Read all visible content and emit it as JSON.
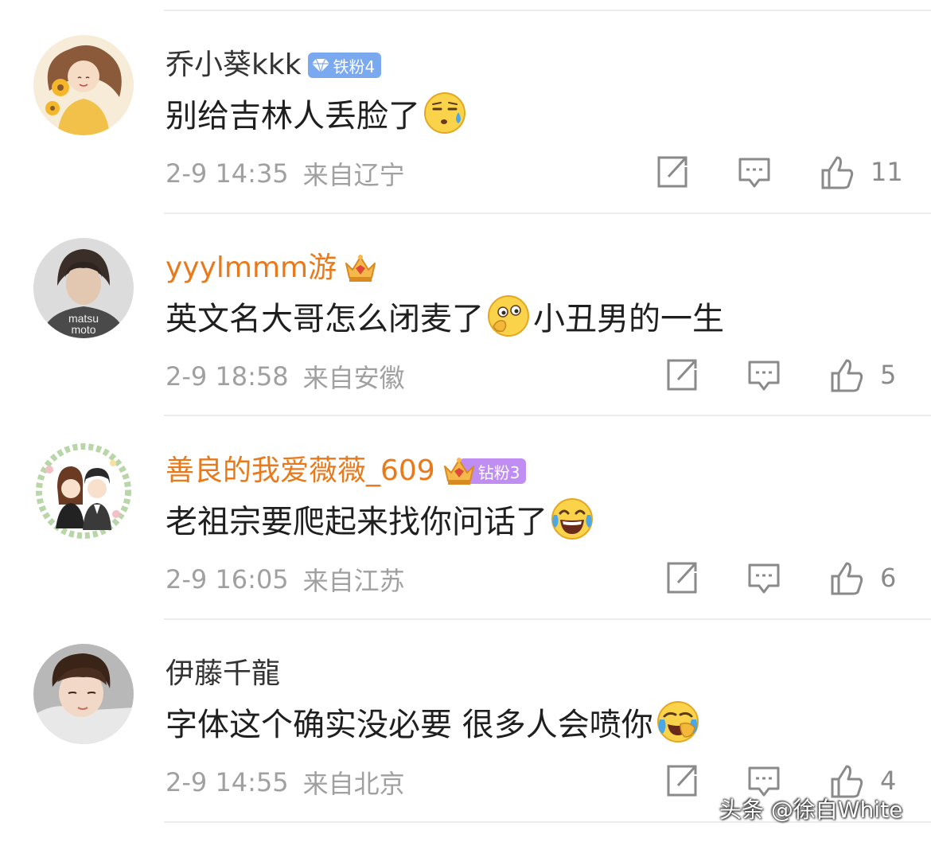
{
  "comments": [
    {
      "username": "乔小葵kkk",
      "badge_text": "铁粉4",
      "content": "别给吉林人丢脸了",
      "content_suffix": "",
      "emoji_name": "sweat-emoji",
      "time": "2-9 14:35",
      "location": "来自辽宁",
      "likes": "11",
      "name_color": "#333333"
    },
    {
      "username": "yyylmmm游",
      "badge_text": "",
      "content": "英文名大哥怎么闭麦了",
      "content_suffix": "小丑男的一生",
      "emoji_name": "thinking-emoji",
      "time": "2-9 18:58",
      "location": "来自安徽",
      "likes": "5",
      "name_color": "#e87a1c"
    },
    {
      "username": "善良的我爱薇薇_609",
      "badge_text": "钻粉3",
      "content": "老祖宗要爬起来找你问话了",
      "content_suffix": "",
      "emoji_name": "laugh-cry-emoji",
      "time": "2-9 16:05",
      "location": "来自江苏",
      "likes": "6",
      "name_color": "#e87a1c"
    },
    {
      "username": "伊藤千龍",
      "badge_text": "",
      "content": "字体这个确实没必要 很多人会喷你",
      "content_suffix": "",
      "emoji_name": "facepalm-cry-emoji",
      "time": "2-9 14:55",
      "location": "来自北京",
      "likes": "4",
      "name_color": "#333333"
    }
  ],
  "avatar_texts": {
    "matsumoto": "matsu moto"
  },
  "watermark": "头条 @徐白White",
  "colors": {
    "gold_name": "#e87a1c",
    "iron_badge": "#7aa9f0",
    "diamond_badge": "#c08ef2",
    "meta_text": "#a0a0a0",
    "icon_gray": "#8a8a8a"
  }
}
